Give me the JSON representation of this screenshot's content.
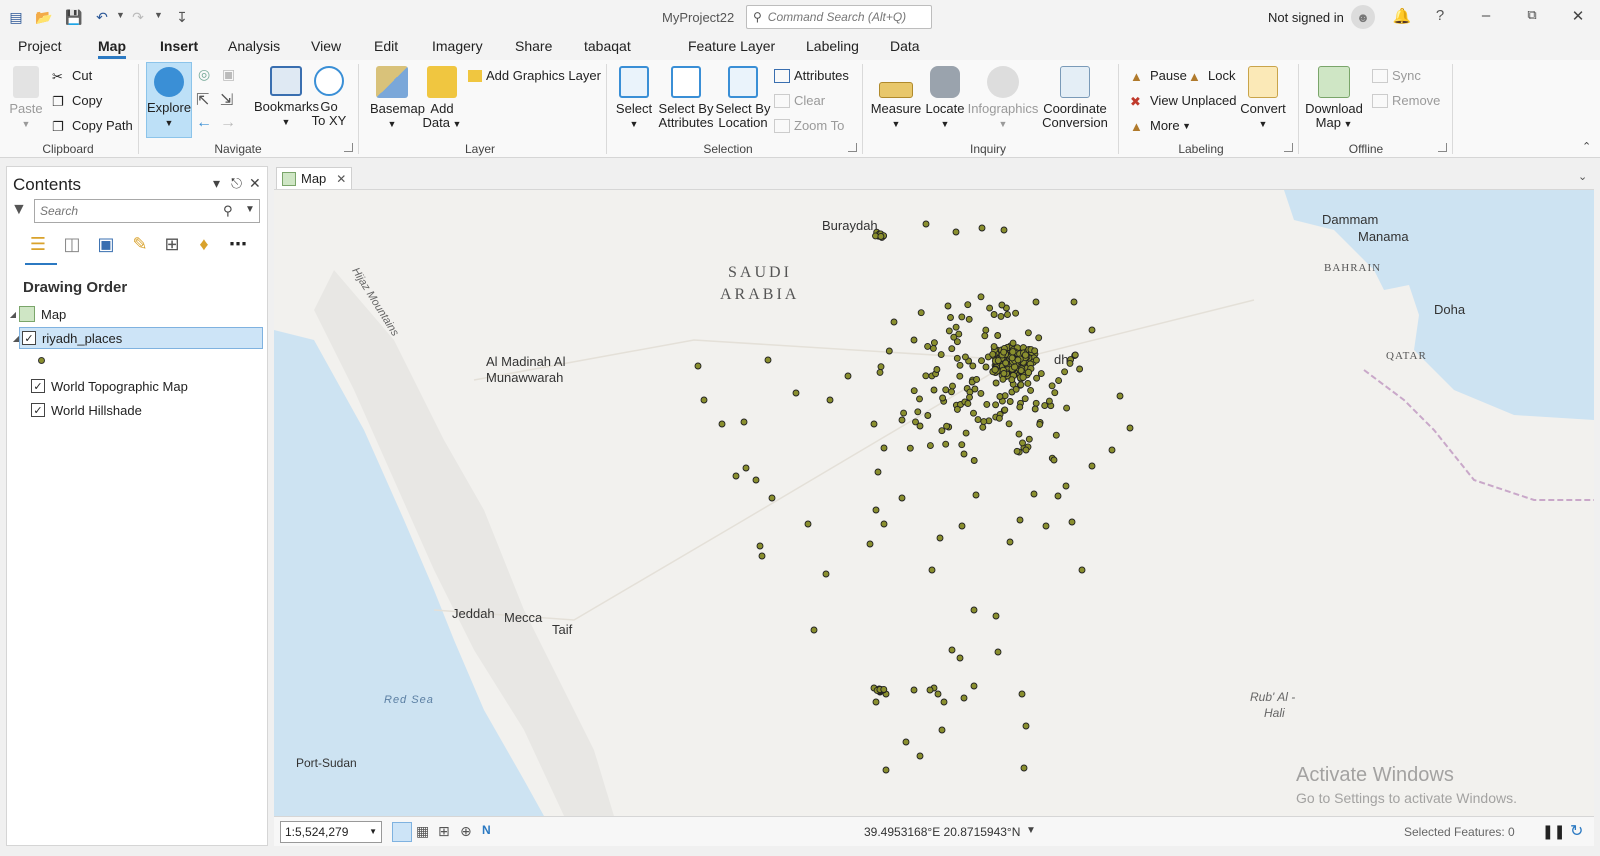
{
  "window": {
    "title": "MyProject22",
    "command_search_placeholder": "Command Search (Alt+Q)",
    "signin": "Not signed in"
  },
  "tabs": [
    "Project",
    "Map",
    "Insert",
    "Analysis",
    "View",
    "Edit",
    "Imagery",
    "Share",
    "tabaqat"
  ],
  "active_tab": "Map",
  "context_tabs": [
    "Feature Layer",
    "Labeling",
    "Data"
  ],
  "ribbon": {
    "clipboard": {
      "label": "Clipboard",
      "paste": "Paste",
      "cut": "Cut",
      "copy": "Copy",
      "copy_path": "Copy Path"
    },
    "navigate": {
      "label": "Navigate",
      "explore": "Explore",
      "bookmarks": "Bookmarks",
      "go_to_xy_1": "Go",
      "go_to_xy_2": "To XY"
    },
    "layer": {
      "label": "Layer",
      "basemap": "Basemap",
      "add_data_1": "Add",
      "add_data_2": "Data",
      "add_graphics_layer": "Add Graphics Layer"
    },
    "selection": {
      "label": "Selection",
      "select": "Select",
      "select_by_attr_1": "Select By",
      "select_by_attr_2": "Attributes",
      "select_by_loc_1": "Select By",
      "select_by_loc_2": "Location",
      "attributes": "Attributes",
      "clear": "Clear",
      "zoom_to": "Zoom To"
    },
    "inquiry": {
      "label": "Inquiry",
      "measure": "Measure",
      "locate": "Locate",
      "infographics": "Infographics",
      "coord_conv_1": "Coordinate",
      "coord_conv_2": "Conversion"
    },
    "labeling": {
      "label": "Labeling",
      "pause": "Pause",
      "lock": "Lock",
      "view_unplaced": "View Unplaced",
      "more": "More",
      "convert": "Convert"
    },
    "offline": {
      "label": "Offline",
      "download_map_1": "Download",
      "download_map_2": "Map",
      "sync": "Sync",
      "remove": "Remove"
    }
  },
  "contents": {
    "title": "Contents",
    "search_placeholder": "Search",
    "drawing_order": "Drawing Order",
    "layers": [
      "Map",
      "riyadh_places",
      "World Topographic Map",
      "World Hillshade"
    ]
  },
  "map": {
    "tab_label": "Map",
    "labels": {
      "buraydah": "Buraydah",
      "saudi": "SAUDI",
      "arabia": "ARABIA",
      "hijaz": "Hijaz Mountains",
      "madinah_1": "Al Madinah Al",
      "madinah_2": "Munawwarah",
      "riyadh_frag": "dh",
      "jeddah": "Jeddah",
      "mecca": "Mecca",
      "taif": "Taif",
      "red_sea": "Red Sea",
      "port_sudan": "Port-Sudan",
      "dammam": "Dammam",
      "manama": "Manama",
      "bahrain": "BAHRAIN",
      "doha": "Doha",
      "qatar": "QATAR",
      "rub_1": "Rub' Al -",
      "rub_2": "Hali"
    },
    "point_color": "#8a8f2e",
    "water_color": "#cde3f2"
  },
  "status": {
    "scale": "1:5,524,279",
    "coordinates": "39.4953168°E 20.8715943°N",
    "selected_features": "Selected Features: 0"
  },
  "watermark": {
    "line1": "Activate Windows",
    "line2": "Go to Settings to activate Windows."
  }
}
